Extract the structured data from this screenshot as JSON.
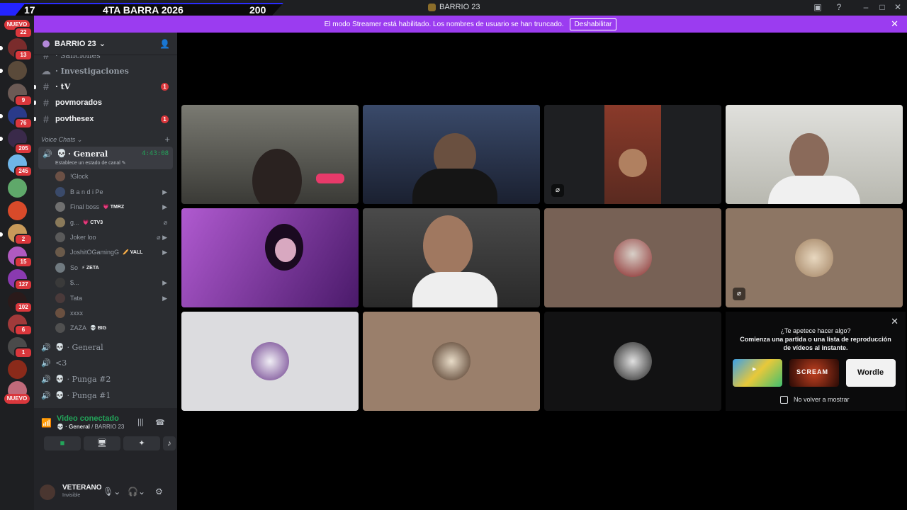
{
  "overlay": {
    "left_num": "17",
    "title": "4TA BARRA 2026",
    "right_num": "200"
  },
  "titlebar": {
    "server_title": "BARRIO 23"
  },
  "banner": {
    "text": "El modo Streamer está habilitado. Los nombres de usuario se han truncado.",
    "button": "Deshabilitar"
  },
  "rail": {
    "new_top": "NUEVO",
    "new_bottom": "NUEVO",
    "badges": [
      "22",
      "13",
      "9",
      "76",
      "205",
      "245",
      "2",
      "15",
      "127",
      "102",
      "6",
      "1"
    ]
  },
  "server": {
    "name": "BARRIO 23"
  },
  "channels": [
    {
      "label": "· Sanciones"
    },
    {
      "label": "· Investigaciones"
    },
    {
      "label": "· tV",
      "badge": "1"
    },
    {
      "label": "povmorados"
    },
    {
      "label": "povthesex",
      "badge": "1"
    }
  ],
  "voice_category": "Voice Chats",
  "active_voice": {
    "name": "· General",
    "time": "4:43:08",
    "status": "Establece un estado de canal"
  },
  "members": [
    {
      "name": "!Glock",
      "tag": ""
    },
    {
      "name": "B a n d i Pe",
      "tag": ""
    },
    {
      "name": "Final boss",
      "tag": "TMRZ"
    },
    {
      "name": "g...",
      "tag": "CTV3"
    },
    {
      "name": "Joker loo",
      "tag": ""
    },
    {
      "name": "JoshitOGamingG",
      "tag": "VALL"
    },
    {
      "name": "So",
      "tag": "ZETA"
    },
    {
      "name": "$...",
      "tag": ""
    },
    {
      "name": "Tata",
      "tag": ""
    },
    {
      "name": "xxxx",
      "tag": ""
    },
    {
      "name": "ZAZA",
      "tag": "BIG"
    }
  ],
  "voice_channels": [
    {
      "name": "· General"
    },
    {
      "name": "<3"
    },
    {
      "name": "· Punga #2"
    },
    {
      "name": "· Punga #1"
    }
  ],
  "voice_panel": {
    "title": "Video conectado",
    "channel": "· General",
    "server": "/ BARRIO 23"
  },
  "user": {
    "name": "VETERANO",
    "status": "Invisible"
  },
  "promo": {
    "question": "¿Te apetece hacer algo?",
    "line1": "Comienza una partida o una lista de reproducción",
    "line2": "de vídeos al instante.",
    "games": [
      "Watch Together",
      "SCREAM",
      "Wordle"
    ],
    "checkbox": "No volver a mostrar"
  },
  "colors": {
    "accent": "#9b3cf0",
    "voice_green": "#23a55a",
    "badge_red": "#da373c",
    "sidebar_bg": "#2b2d31",
    "rail_bg": "#1e1f22"
  }
}
